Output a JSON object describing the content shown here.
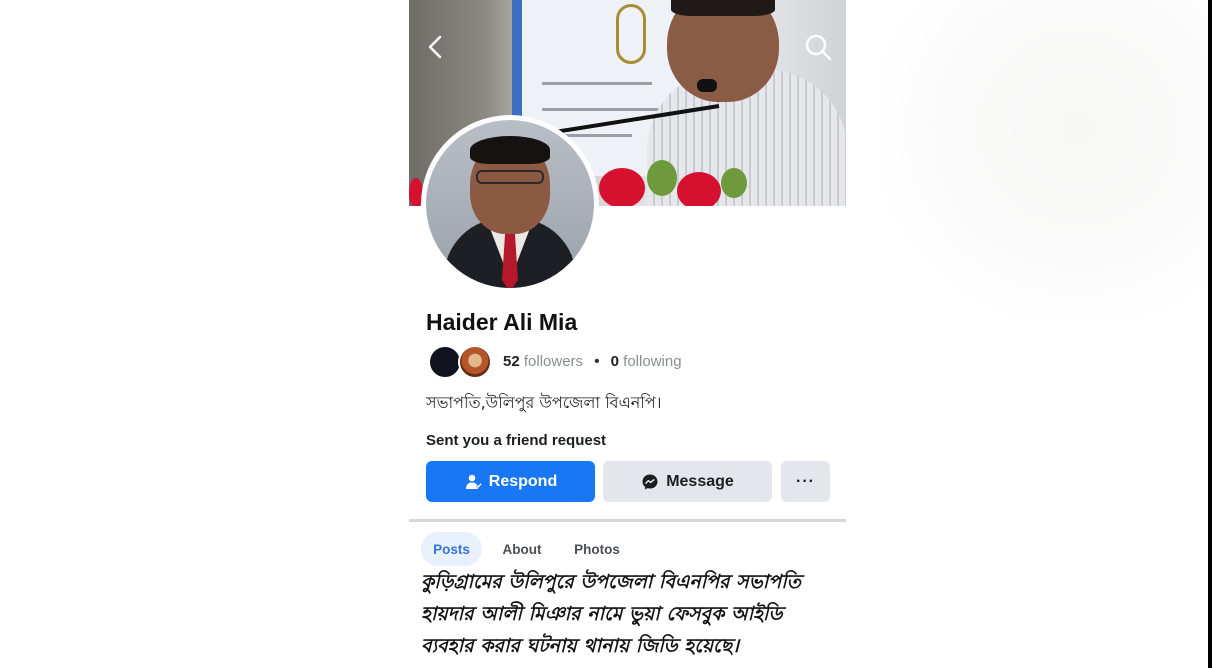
{
  "profile": {
    "name": "Haider Ali Mia",
    "followers_count": "52",
    "followers_label": "followers",
    "following_count": "0",
    "following_label": "following",
    "bio": "সভাপতি,উলিপুর উপজেলা বিএনপি।",
    "request_text": "Sent you a friend request"
  },
  "actions": {
    "respond_label": "Respond",
    "message_label": "Message",
    "more_label": "···"
  },
  "tabs": [
    {
      "label": "Posts",
      "active": true
    },
    {
      "label": "About",
      "active": false
    },
    {
      "label": "Photos",
      "active": false
    }
  ],
  "caption": "কুড়িগ্রামের উলিপুরে উপজেলা বিএনপির সভাপতি হায়দার আলী মিঞার নামে ভুয়া ফেসবুক আইডি ব্যবহার করার ঘটনায় থানায় জিডি হয়েছে।",
  "icons": {
    "back": "back-arrow-icon",
    "search": "search-icon",
    "respond": "person-respond-icon",
    "message": "messenger-icon"
  },
  "colors": {
    "primary": "#1877f2",
    "secondary_button": "#e4e6eb",
    "active_tab_bg": "#e7f0fb",
    "active_tab_text": "#3574d8"
  }
}
